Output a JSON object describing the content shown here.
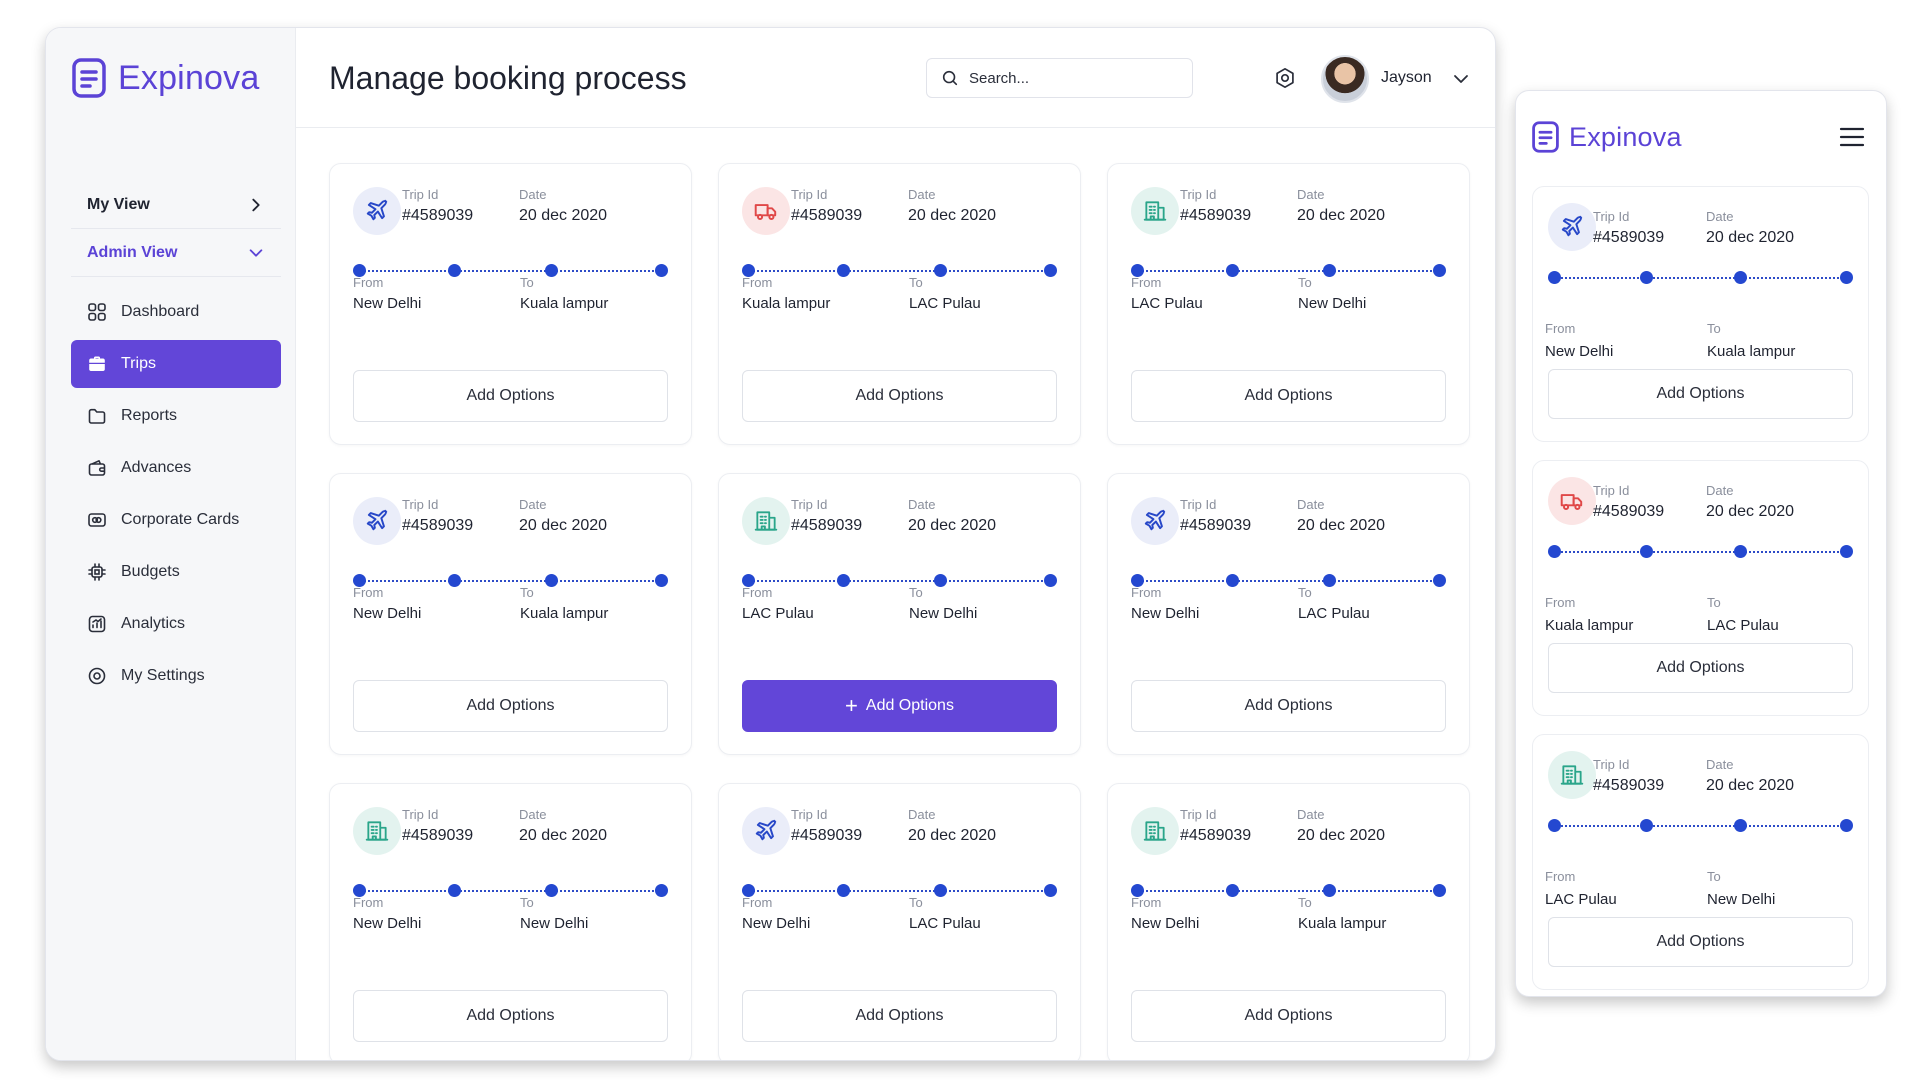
{
  "app": {
    "name": "Expinova"
  },
  "sidebar": {
    "my_view": "My View",
    "admin_view": "Admin View",
    "items": [
      {
        "label": "Dashboard",
        "icon": "grid-icon",
        "active": false
      },
      {
        "label": "Trips",
        "icon": "briefcase-icon",
        "active": true
      },
      {
        "label": "Reports",
        "icon": "folder-icon",
        "active": false
      },
      {
        "label": "Advances",
        "icon": "wallet-icon",
        "active": false
      },
      {
        "label": "Corporate Cards",
        "icon": "card-icon",
        "active": false
      },
      {
        "label": "Budgets",
        "icon": "chip-icon",
        "active": false
      },
      {
        "label": "Analytics",
        "icon": "analytics-icon",
        "active": false
      },
      {
        "label": "My Settings",
        "icon": "settings-icon",
        "active": false
      }
    ]
  },
  "header": {
    "title": "Manage booking process",
    "search_placeholder": "Search...",
    "user_name": "Jayson"
  },
  "labels": {
    "trip_id": "Trip Id",
    "date": "Date",
    "from": "From",
    "to": "To",
    "add_options": "Add Options"
  },
  "trips": [
    {
      "type": "plane",
      "trip_id": "#4589039",
      "date": "20 dec 2020",
      "from": "New Delhi",
      "to": "Kuala lampur",
      "button_primary": false
    },
    {
      "type": "truck",
      "trip_id": "#4589039",
      "date": "20 dec 2020",
      "from": "Kuala lampur",
      "to": "LAC Pulau",
      "button_primary": false
    },
    {
      "type": "hotel",
      "trip_id": "#4589039",
      "date": "20 dec 2020",
      "from": "LAC Pulau",
      "to": "New Delhi",
      "button_primary": false
    },
    {
      "type": "plane",
      "trip_id": "#4589039",
      "date": "20 dec 2020",
      "from": "New Delhi",
      "to": "Kuala lampur",
      "button_primary": false
    },
    {
      "type": "hotel",
      "trip_id": "#4589039",
      "date": "20 dec 2020",
      "from": "LAC Pulau",
      "to": "New Delhi",
      "button_primary": true
    },
    {
      "type": "plane",
      "trip_id": "#4589039",
      "date": "20 dec 2020",
      "from": "New Delhi",
      "to": "LAC Pulau",
      "button_primary": false
    },
    {
      "type": "hotel",
      "trip_id": "#4589039",
      "date": "20 dec 2020",
      "from": "New Delhi",
      "to": "New Delhi",
      "button_primary": false
    },
    {
      "type": "plane",
      "trip_id": "#4589039",
      "date": "20 dec 2020",
      "from": "New Delhi",
      "to": "LAC Pulau",
      "button_primary": false
    },
    {
      "type": "hotel",
      "trip_id": "#4589039",
      "date": "20 dec 2020",
      "from": "New Delhi",
      "to": "Kuala lampur",
      "button_primary": false
    }
  ],
  "mobile_trips": [
    {
      "type": "plane",
      "trip_id": "#4589039",
      "date": "20 dec 2020",
      "from": "New Delhi",
      "to": "Kuala lampur"
    },
    {
      "type": "truck",
      "trip_id": "#4589039",
      "date": "20 dec 2020",
      "from": "Kuala lampur",
      "to": "LAC Pulau"
    },
    {
      "type": "hotel",
      "trip_id": "#4589039",
      "date": "20 dec 2020",
      "from": "LAC Pulau",
      "to": "New Delhi"
    }
  ],
  "colors": {
    "brand": "#5b43d6",
    "primary": "#6246d8",
    "route_dot": "#2448d0",
    "plane_icon": "#2848c8",
    "truck_icon": "#e04848",
    "hotel_icon": "#2aa58a"
  }
}
